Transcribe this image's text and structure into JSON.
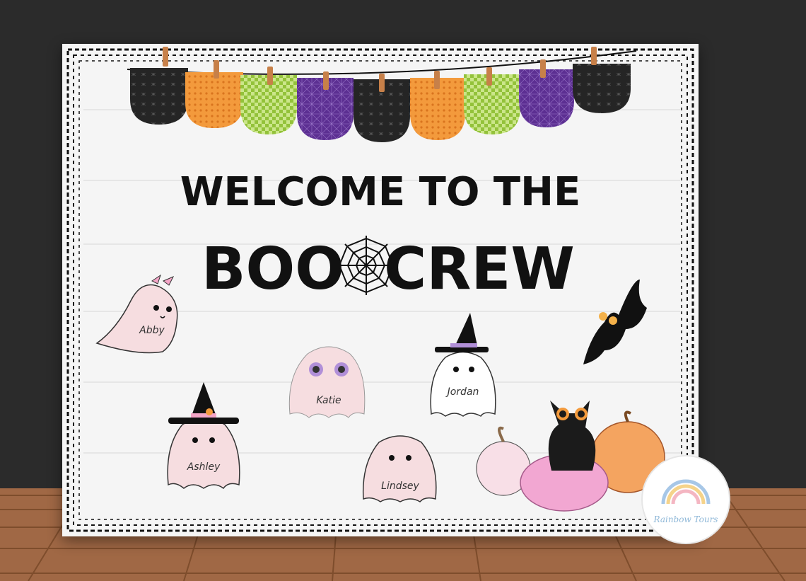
{
  "board": {
    "title_line1": "WELCOME TO THE",
    "title_word_left": "BOO",
    "title_word_right": "CREW"
  },
  "ghost_names": [
    "Abby",
    "Katie",
    "Jordan",
    "Ashley",
    "Lindsey"
  ],
  "watermark": "Rainbow Tours",
  "colors": {
    "chalkboard": "#2b2b2b",
    "floor": "#a36a45",
    "board_white": "#f4f4f4",
    "ghost_pink": "#f6dde0",
    "pumpkin_orange": "#f4a460",
    "pumpkin_pink": "#f2a7d2",
    "pennant_black": "#222222",
    "pennant_orange": "#f39a3c",
    "pennant_green": "#a8d24a",
    "pennant_purple": "#6a3aa0"
  },
  "pennants": [
    "black",
    "orange",
    "green",
    "purple",
    "black",
    "orange",
    "green",
    "purple",
    "black"
  ]
}
